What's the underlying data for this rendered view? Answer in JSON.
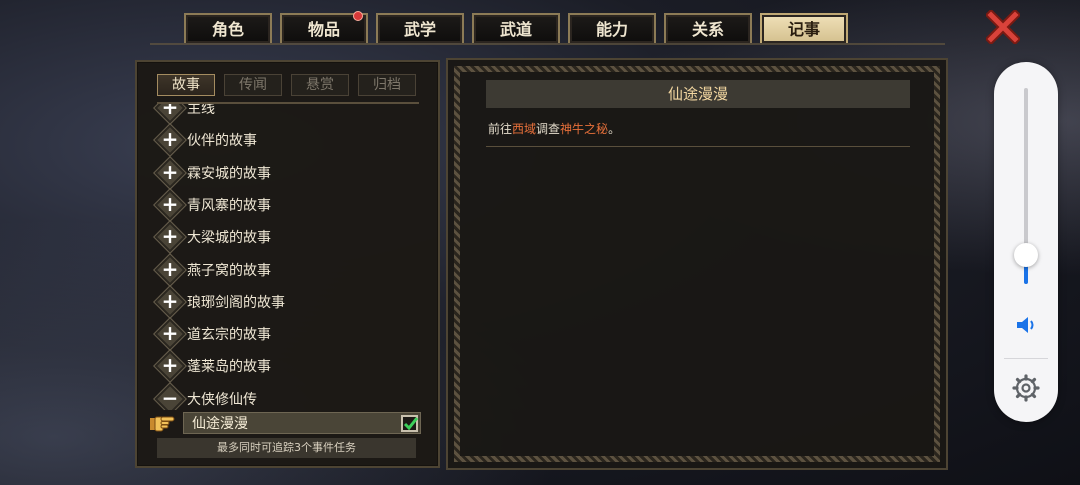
{
  "top_tabs": [
    {
      "label": "角色",
      "active": false,
      "badge": false
    },
    {
      "label": "物品",
      "active": false,
      "badge": true
    },
    {
      "label": "武学",
      "active": false,
      "badge": false
    },
    {
      "label": "武道",
      "active": false,
      "badge": false
    },
    {
      "label": "能力",
      "active": false,
      "badge": false
    },
    {
      "label": "关系",
      "active": false,
      "badge": false
    },
    {
      "label": "记事",
      "active": true,
      "badge": false
    }
  ],
  "sub_tabs": [
    {
      "label": "故事",
      "active": true
    },
    {
      "label": "传闻",
      "active": false
    },
    {
      "label": "悬赏",
      "active": false
    },
    {
      "label": "归档",
      "active": false
    }
  ],
  "story_list": [
    {
      "label": "主线",
      "expanded": false
    },
    {
      "label": "伙伴的故事",
      "expanded": false
    },
    {
      "label": "霖安城的故事",
      "expanded": false
    },
    {
      "label": "青风寨的故事",
      "expanded": false
    },
    {
      "label": "大梁城的故事",
      "expanded": false
    },
    {
      "label": "燕子窝的故事",
      "expanded": false
    },
    {
      "label": "琅琊剑阁的故事",
      "expanded": false
    },
    {
      "label": "道玄宗的故事",
      "expanded": false
    },
    {
      "label": "蓬莱岛的故事",
      "expanded": false
    },
    {
      "label": "大侠修仙传",
      "expanded": true
    }
  ],
  "selected_quest": {
    "label": "仙途漫漫",
    "tracked": true
  },
  "footer_note": "最多同时可追踪3个事件任务",
  "quest_detail": {
    "title": "仙途漫漫",
    "desc_parts": [
      {
        "text": "前往",
        "highlight": false
      },
      {
        "text": "西域",
        "highlight": true
      },
      {
        "text": "调查",
        "highlight": false
      },
      {
        "text": "神牛之秘",
        "highlight": true
      },
      {
        "text": "。",
        "highlight": false
      }
    ]
  },
  "volume_level": 0.15,
  "colors": {
    "accent": "#1a73e8",
    "highlight": "#e8703a",
    "title_text": "#f2d6a0"
  },
  "icons": {
    "close": "close-icon",
    "speaker": "speaker-icon",
    "settings": "gear-icon",
    "pointer": "pointing-hand-icon",
    "check": "check-icon"
  }
}
